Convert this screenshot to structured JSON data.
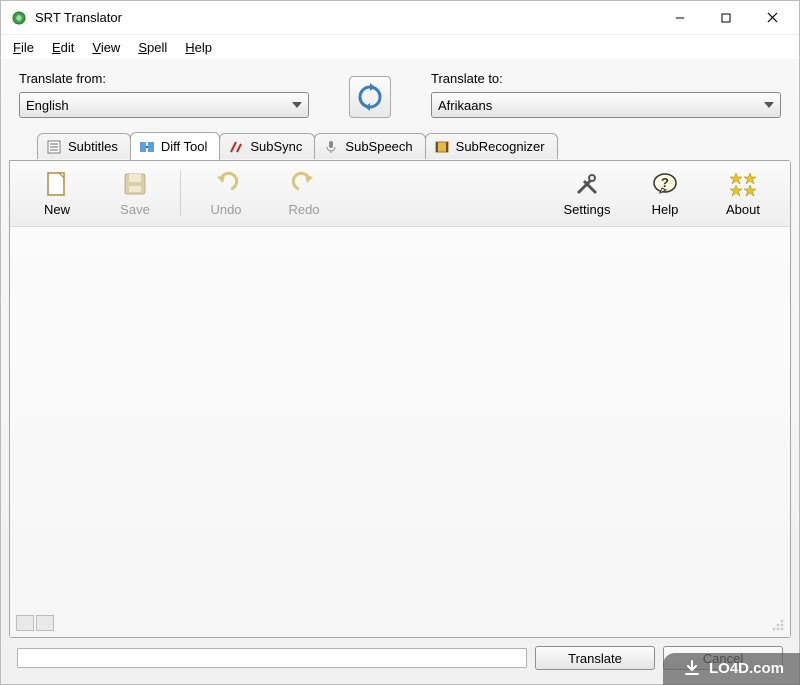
{
  "window": {
    "title": "SRT Translator"
  },
  "menu": {
    "items": [
      "File",
      "Edit",
      "View",
      "Spell",
      "Help"
    ]
  },
  "langFrom": {
    "label": "Translate from:",
    "value": "English"
  },
  "langTo": {
    "label": "Translate to:",
    "value": "Afrikaans"
  },
  "tabs": {
    "items": [
      {
        "label": "Subtitles",
        "icon": "list-icon"
      },
      {
        "label": "Diff Tool",
        "icon": "diff-icon"
      },
      {
        "label": "SubSync",
        "icon": "sync-icon"
      },
      {
        "label": "SubSpeech",
        "icon": "mic-icon"
      },
      {
        "label": "SubRecognizer",
        "icon": "film-icon"
      }
    ],
    "activeIndex": 1
  },
  "toolbar": {
    "new": "New",
    "save": "Save",
    "undo": "Undo",
    "redo": "Redo",
    "settings": "Settings",
    "help": "Help",
    "about": "About"
  },
  "footer": {
    "translate": "Translate",
    "cancel": "Cancel"
  },
  "watermark": "LO4D.com"
}
